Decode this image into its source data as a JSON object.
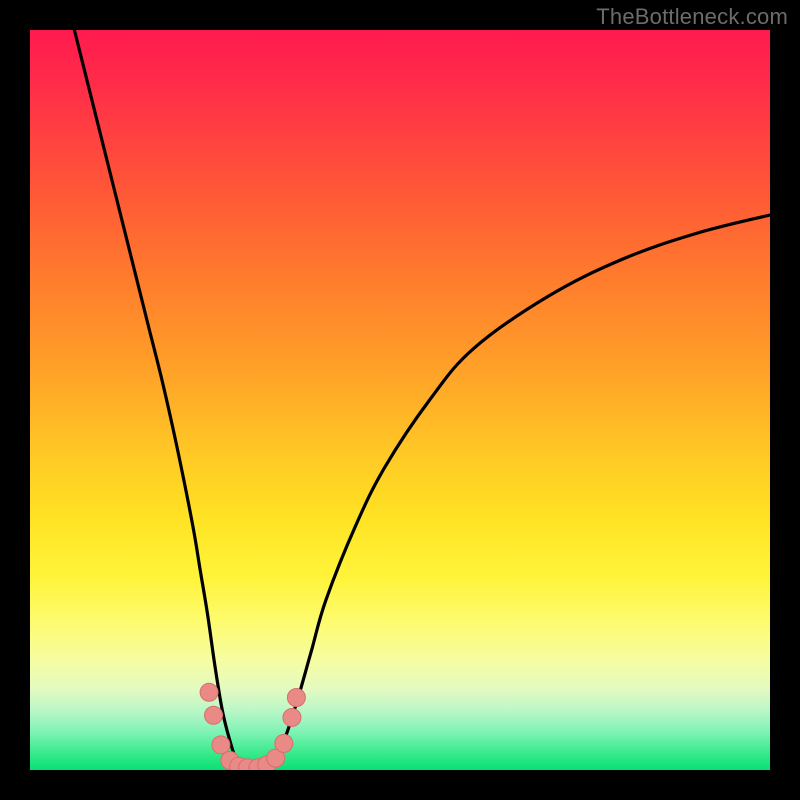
{
  "watermark": "TheBottleneck.com",
  "colors": {
    "background": "#000000",
    "curve": "#000000",
    "marker_fill": "#e98a86",
    "marker_stroke": "#d66f6b",
    "gradient_top": "#ff1a4e",
    "gradient_bottom": "#08e173"
  },
  "chart_data": {
    "type": "line",
    "title": "",
    "xlabel": "",
    "ylabel": "",
    "xlim": [
      0,
      100
    ],
    "ylim": [
      0,
      100
    ],
    "series": [
      {
        "name": "bottleneck-curve",
        "x": [
          6,
          8,
          10,
          12,
          14,
          16,
          18,
          20,
          22,
          23,
          24,
          25,
          26,
          27,
          28,
          29,
          30,
          31,
          32,
          33,
          34,
          36,
          38,
          40,
          44,
          48,
          54,
          60,
          70,
          80,
          90,
          100
        ],
        "y": [
          100,
          92,
          84,
          76,
          68,
          60,
          52,
          43,
          33,
          27,
          21,
          14,
          8,
          4,
          1,
          0,
          0,
          0,
          0,
          1,
          3,
          9,
          16,
          23,
          33,
          41,
          50,
          57,
          64,
          69,
          72.5,
          75
        ]
      }
    ],
    "markers": {
      "name": "highlight-dots",
      "points": [
        {
          "x": 24.2,
          "y": 10.5
        },
        {
          "x": 24.8,
          "y": 7.4
        },
        {
          "x": 25.8,
          "y": 3.4
        },
        {
          "x": 27.0,
          "y": 1.3
        },
        {
          "x": 28.2,
          "y": 0.5
        },
        {
          "x": 29.4,
          "y": 0.3
        },
        {
          "x": 30.8,
          "y": 0.3
        },
        {
          "x": 32.0,
          "y": 0.7
        },
        {
          "x": 33.2,
          "y": 1.6
        },
        {
          "x": 34.3,
          "y": 3.6
        },
        {
          "x": 35.4,
          "y": 7.1
        },
        {
          "x": 36.0,
          "y": 9.8
        }
      ],
      "radius": 9
    }
  }
}
